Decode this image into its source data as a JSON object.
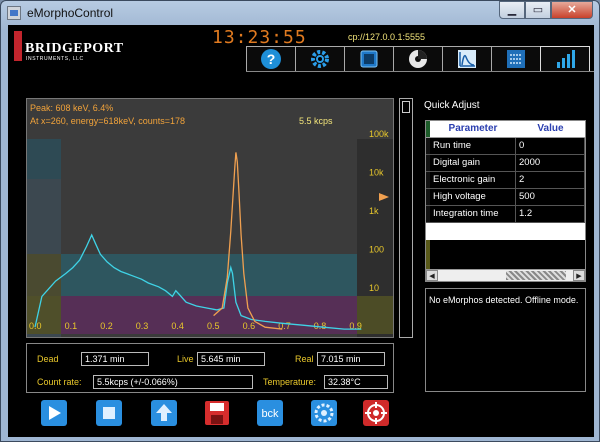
{
  "window": {
    "title": "eMorphoControl"
  },
  "header": {
    "logo_text": "BRIDGEPORT",
    "logo_sub": "INSTRUMENTS, LLC",
    "clock": "13:23:55",
    "address": "cp://127.0.0.1:5555"
  },
  "toolbar": {
    "buttons": [
      "help-icon",
      "settings-gear-icon",
      "battery-icon",
      "detector-icon",
      "pulse-shape-icon",
      "list-mode-icon",
      "histogram-icon"
    ],
    "selected": "histogram-icon"
  },
  "plot": {
    "peak_text": "Peak: 608 keV, 6.4%",
    "cursor_text": "At x=260, energy=618keV, counts=178",
    "rate_text": "5.5 kcps"
  },
  "chart_data": {
    "type": "line",
    "x_ticks": [
      "0.0",
      "0.1",
      "0.2",
      "0.3",
      "0.4",
      "0.5",
      "0.6",
      "0.7",
      "0.8",
      "0.9"
    ],
    "y_ticks": [
      "10",
      "100",
      "1k",
      "10k",
      "100k"
    ],
    "yscale": "log",
    "grid": false,
    "series": [
      {
        "color": "#3fd3e6",
        "points": [
          [
            0.0,
            0.02
          ],
          [
            0.02,
            0.18
          ],
          [
            0.04,
            0.22
          ],
          [
            0.06,
            0.26
          ],
          [
            0.09,
            0.3
          ],
          [
            0.11,
            0.33
          ],
          [
            0.13,
            0.37
          ],
          [
            0.15,
            0.44
          ],
          [
            0.165,
            0.5
          ],
          [
            0.175,
            0.46
          ],
          [
            0.19,
            0.4
          ],
          [
            0.21,
            0.36
          ],
          [
            0.23,
            0.33
          ],
          [
            0.25,
            0.31
          ],
          [
            0.28,
            0.29
          ],
          [
            0.31,
            0.27
          ],
          [
            0.33,
            0.25
          ],
          [
            0.36,
            0.23
          ],
          [
            0.38,
            0.21
          ],
          [
            0.4,
            0.18
          ],
          [
            0.41,
            0.21
          ],
          [
            0.42,
            0.19
          ],
          [
            0.44,
            0.15
          ],
          [
            0.47,
            0.13
          ],
          [
            0.5,
            0.12
          ],
          [
            0.53,
            0.11
          ],
          [
            0.55,
            0.12
          ],
          [
            0.56,
            0.25
          ],
          [
            0.57,
            0.33
          ],
          [
            0.575,
            0.3
          ],
          [
            0.585,
            0.15
          ],
          [
            0.6,
            0.08
          ],
          [
            0.63,
            0.06
          ],
          [
            0.67,
            0.05
          ],
          [
            0.72,
            0.04
          ],
          [
            0.78,
            0.03
          ],
          [
            0.84,
            0.02
          ],
          [
            0.9,
            0.01
          ],
          [
            0.95,
            0.01
          ]
        ]
      },
      {
        "color": "#f0a050",
        "points": [
          [
            0.52,
            0.08
          ],
          [
            0.545,
            0.12
          ],
          [
            0.56,
            0.28
          ],
          [
            0.57,
            0.52
          ],
          [
            0.577,
            0.72
          ],
          [
            0.582,
            0.86
          ],
          [
            0.585,
            0.93
          ],
          [
            0.589,
            0.88
          ],
          [
            0.594,
            0.72
          ],
          [
            0.6,
            0.5
          ],
          [
            0.608,
            0.3
          ],
          [
            0.62,
            0.12
          ],
          [
            0.64,
            0.05
          ],
          [
            0.67,
            0.02
          ],
          [
            0.72,
            0.01
          ]
        ]
      }
    ]
  },
  "stats": {
    "dead_label": "Dead",
    "dead_value": "1.371 min",
    "live_label": "Live",
    "live_value": "5.645 min",
    "real_label": "Real",
    "real_value": "7.015 min",
    "count_rate_label": "Count rate:",
    "count_rate_value": "5.5kcps (+/-0.066%)",
    "temperature_label": "Temperature:",
    "temperature_value": "32.38°C"
  },
  "quick_adjust": {
    "title": "Quick Adjust",
    "headers": [
      "Parameter",
      "Value"
    ],
    "rows": [
      [
        "Run time",
        "0"
      ],
      [
        "Digital gain",
        "2000"
      ],
      [
        "Electronic gain",
        "2"
      ],
      [
        "High voltage",
        "500"
      ],
      [
        "Integration time",
        "1.2"
      ]
    ]
  },
  "status_message": "No eMorphos detected. Offline mode.",
  "bottom_bar": {
    "bck_label": "bck",
    "icons": [
      "play-icon",
      "stop-icon",
      "upload-icon",
      "save-icon",
      "bck-icon",
      "settings-icon",
      "target-icon"
    ]
  },
  "colors": {
    "accent": "#e9c82b",
    "peak": "#f0a050",
    "spectrum": "#3fd3e6",
    "clock": "#e07a20"
  }
}
